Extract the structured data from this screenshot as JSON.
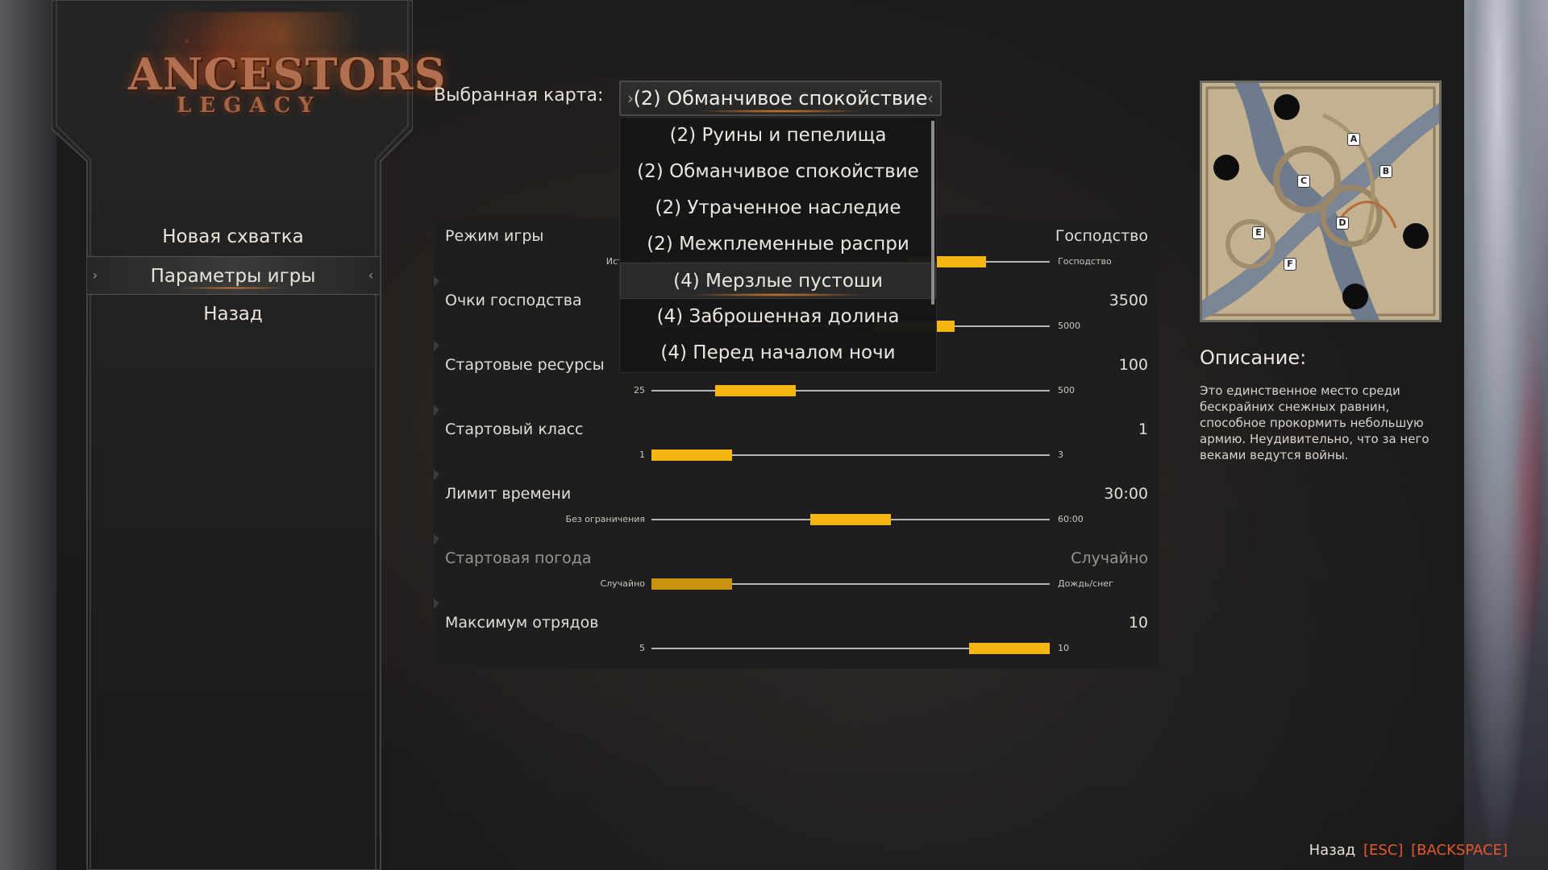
{
  "logo": {
    "main": "ANCESTORS",
    "sub": "LEGACY"
  },
  "menu": {
    "items": [
      {
        "label": "Новая схватка",
        "active": false
      },
      {
        "label": "Параметры игры",
        "active": true
      },
      {
        "label": "Назад",
        "active": false
      }
    ]
  },
  "map_selector": {
    "label": "Выбранная карта:",
    "selected": "(2) Обманчивое спокойствие",
    "options": [
      "(2) Руины и пепелища",
      "(2) Обманчивое спокойствие",
      "(2) Утраченное наследие",
      "(2) Межплеменные распри",
      "(4) Мерзлые пустоши",
      "(4) Заброшенная долина",
      "(4) Перед началом ночи"
    ],
    "hovered_option": "(4) Мерзлые пустоши"
  },
  "settings": [
    {
      "name": "Режим игры",
      "value": "Господство",
      "min": "Истребл",
      "max": "Господство",
      "level": 0.8,
      "disabled": false
    },
    {
      "name": "Очки господства",
      "value": "3500",
      "min": "",
      "max": "5000",
      "level": 0.7,
      "disabled": false
    },
    {
      "name": "Стартовые ресурсы",
      "value": "100",
      "min": "25",
      "max": "500",
      "level": 0.2,
      "disabled": false
    },
    {
      "name": "Стартовый класс",
      "value": "1",
      "min": "1",
      "max": "3",
      "level": 0.0,
      "disabled": false
    },
    {
      "name": "Лимит времени",
      "value": "30:00",
      "min": "Без ограничения",
      "max": "60:00",
      "level": 0.5,
      "disabled": false
    },
    {
      "name": "Стартовая погода",
      "value": "Случайно",
      "min": "Случайно",
      "max": "Дождь/снег",
      "level": 0.0,
      "disabled": true
    },
    {
      "name": "Максимум отрядов",
      "value": "10",
      "min": "5",
      "max": "10",
      "level": 1.0,
      "disabled": false
    }
  ],
  "preview": {
    "bases": [
      "A",
      "B",
      "C",
      "D",
      "E",
      "F"
    ]
  },
  "description": {
    "title": "Описание:",
    "text": "Это единственное место среди бескрайних снежных равнин, способное прокормить небольшую армию. Неудивительно, что за него веками ведутся войны."
  },
  "footer": {
    "label": "Назад",
    "key1": "[ESC]",
    "key2": "[BACKSPACE]"
  },
  "colors": {
    "slider_thumb": "#f5b512",
    "accent_glow": "#ff8c28",
    "key_hint": "#e4582c"
  }
}
